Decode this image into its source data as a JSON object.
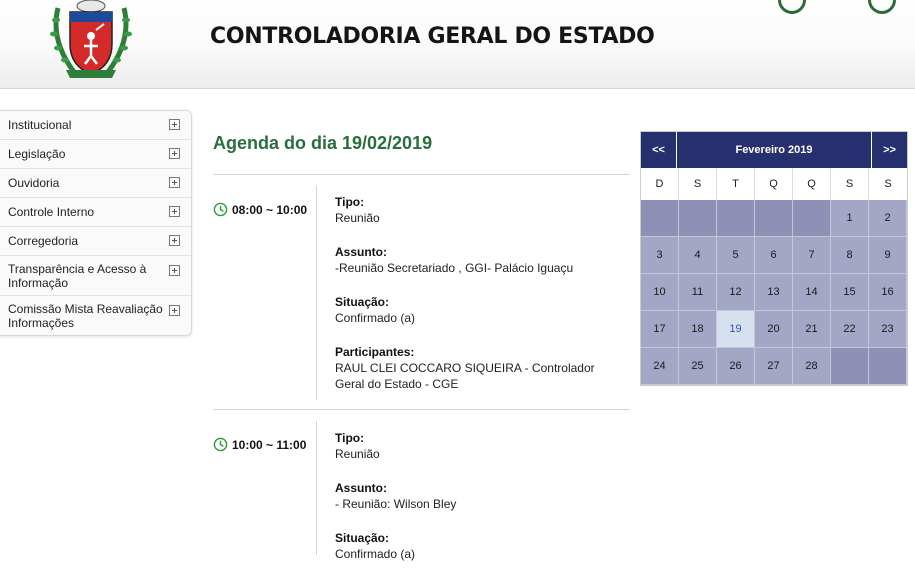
{
  "header": {
    "title": "CONTROLADORIA GERAL DO ESTADO"
  },
  "sidebar": {
    "items": [
      {
        "label": "Institucional",
        "name": "institucional"
      },
      {
        "label": "Legislação",
        "name": "legislacao"
      },
      {
        "label": "Ouvidoria",
        "name": "ouvidoria"
      },
      {
        "label": "Controle Interno",
        "name": "controle-interno"
      },
      {
        "label": "Corregedoria",
        "name": "corregedoria"
      },
      {
        "label": "Transparência e Acesso à Informação",
        "name": "transparencia"
      },
      {
        "label": "Comissão Mista Reavaliação Informações",
        "name": "comissao-mista"
      }
    ]
  },
  "agenda": {
    "title": "Agenda do dia 19/02/2019",
    "events": [
      {
        "time": "08:00 ~ 10:00",
        "tipo_label": "Tipo:",
        "tipo": "Reunião",
        "assunto_label": "Assunto:",
        "assunto": "-Reunião Secretariado , GGI- Palácio Iguaçu",
        "situacao_label": "Situação:",
        "situacao": "Confirmado (a)",
        "participantes_label": "Participantes:",
        "participantes": "RAUL CLEI COCCARO SIQUEIRA - Controlador Geral do Estado - CGE"
      },
      {
        "time": "10:00 ~ 11:00",
        "tipo_label": "Tipo:",
        "tipo": "Reunião",
        "assunto_label": "Assunto:",
        "assunto": "- Reunião: Wilson Bley",
        "situacao_label": "Situação:",
        "situacao": "Confirmado (a)"
      }
    ]
  },
  "calendar": {
    "prev": "<<",
    "next": ">>",
    "month": "Fevereiro 2019",
    "weekdays": [
      "D",
      "S",
      "T",
      "Q",
      "Q",
      "S",
      "S"
    ],
    "leading_blanks": 5,
    "days": [
      "1",
      "2",
      "3",
      "4",
      "5",
      "6",
      "7",
      "8",
      "9",
      "10",
      "11",
      "12",
      "13",
      "14",
      "15",
      "16",
      "17",
      "18",
      "19",
      "20",
      "21",
      "22",
      "23",
      "24",
      "25",
      "26",
      "27",
      "28"
    ],
    "today": "19",
    "trailing_blanks": 2
  },
  "colors": {
    "title_green": "#2a6e3d",
    "calendar_header": "#27306e",
    "calendar_day": "#a4a6c6",
    "calendar_today": "#d7e0ee"
  }
}
